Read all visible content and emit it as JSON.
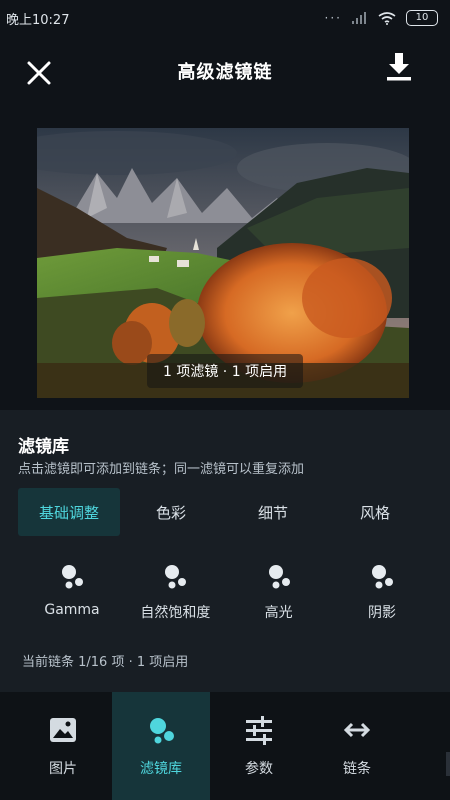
{
  "status_bar": {
    "time": "晚上10:27",
    "battery": "10",
    "signal_dots": "··· "
  },
  "header": {
    "title": "高级滤镜链",
    "close_icon": "close-icon",
    "download_icon": "download-icon"
  },
  "preview": {
    "chip_text": "1 项滤镜 · 1 项启用"
  },
  "library": {
    "title": "滤镜库",
    "subtitle": "点击滤镜即可添加到链条；同一滤镜可以重复添加",
    "tabs": [
      {
        "label": "基础调整",
        "active": true
      },
      {
        "label": "色彩",
        "active": false
      },
      {
        "label": "细节",
        "active": false
      },
      {
        "label": "风格",
        "active": false
      }
    ],
    "filters": [
      {
        "label": "Gamma",
        "icon": "filter-dots-icon"
      },
      {
        "label": "自然饱和度",
        "icon": "filter-dots-icon"
      },
      {
        "label": "高光",
        "icon": "filter-dots-icon"
      },
      {
        "label": "阴影",
        "icon": "filter-dots-icon"
      }
    ],
    "chain_info": "当前链条 1/16 项 · 1 项启用"
  },
  "bottom_nav": {
    "items": [
      {
        "label": "图片",
        "icon": "image-icon",
        "active": false
      },
      {
        "label": "滤镜库",
        "icon": "filter-library-icon",
        "active": true
      },
      {
        "label": "参数",
        "icon": "sliders-icon",
        "active": false
      },
      {
        "label": "链条",
        "icon": "swap-arrows-icon",
        "active": false
      }
    ]
  },
  "colors": {
    "accent": "#4fd6dd",
    "active_bg": "#16353a",
    "panel_bg": "#181e24",
    "page_bg": "#0f1318"
  }
}
